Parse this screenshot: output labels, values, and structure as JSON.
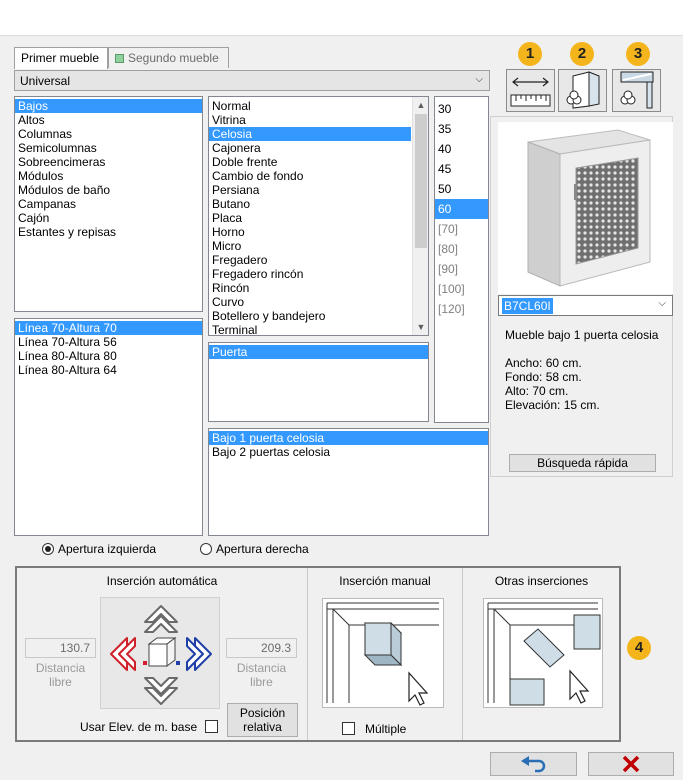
{
  "tabs": [
    {
      "label": "Primer mueble",
      "active": true
    },
    {
      "label": "Segundo mueble",
      "active": false
    }
  ],
  "catalog_select": {
    "value": "Universal"
  },
  "categories": [
    "Bajos",
    "Altos",
    "Columnas",
    "Semicolumnas",
    "Sobreencimeras",
    "Módulos",
    "Módulos de baño",
    "Campanas",
    "Cajón",
    "Estantes y repisas"
  ],
  "categories_selected": 0,
  "lines": [
    "Línea 70-Altura 70",
    "Línea 70-Altura 56",
    "Línea 80-Altura 80",
    "Línea 80-Altura 64"
  ],
  "lines_selected": 0,
  "types": [
    "Normal",
    "Vitrina",
    "Celosia",
    "Cajonera",
    "Doble frente",
    "Cambio de fondo",
    "Persiana",
    "Butano",
    "Placa",
    "Horno",
    "Micro",
    "Fregadero",
    "Fregadero rincón",
    "Rincón",
    "Curvo",
    "Botellero y bandejero",
    "Terminal"
  ],
  "types_selected": 2,
  "widths": [
    {
      "label": "30",
      "enabled": true
    },
    {
      "label": "35",
      "enabled": true
    },
    {
      "label": "40",
      "enabled": true
    },
    {
      "label": "45",
      "enabled": true
    },
    {
      "label": "50",
      "enabled": true
    },
    {
      "label": "60",
      "enabled": true
    },
    {
      "label": "[70]",
      "enabled": false
    },
    {
      "label": "[80]",
      "enabled": false
    },
    {
      "label": "[90]",
      "enabled": false
    },
    {
      "label": "[100]",
      "enabled": false
    },
    {
      "label": "[120]",
      "enabled": false
    }
  ],
  "widths_selected": 5,
  "subtypes": [
    "Puerta"
  ],
  "models": [
    "Bajo 1 puerta celosia",
    "Bajo 2 puertas celosia"
  ],
  "models_selected": 0,
  "badges": [
    "1",
    "2",
    "3",
    "4"
  ],
  "code_select": {
    "value": "B7CL60I"
  },
  "info": {
    "description": "Mueble bajo 1 puerta celosia",
    "ancho": "Ancho: 60 cm.",
    "fondo": "Fondo: 58 cm.",
    "alto": "Alto: 70 cm.",
    "elevacion": "Elevación: 15 cm."
  },
  "quick_search_label": "Búsqueda rápida",
  "opening": {
    "left": "Apertura izquierda",
    "right": "Apertura derecha",
    "selected": "left"
  },
  "auto_insert": {
    "title": "Inserción automática",
    "left_value": "130.7",
    "right_value": "209.3",
    "distance_label_line1": "Distancia",
    "distance_label_line2": "libre",
    "use_elev_label": "Usar Elev. de m. base",
    "relative_line1": "Posición",
    "relative_line2": "relativa"
  },
  "manual_insert": {
    "title": "Inserción manual",
    "multiple_label": "Múltiple"
  },
  "other_insert": {
    "title": "Otras inserciones"
  },
  "colors": {
    "selection": "#3399ff",
    "badge": "#f3b51b",
    "cancel": "#c00000",
    "undo": "#2a6fb5"
  }
}
